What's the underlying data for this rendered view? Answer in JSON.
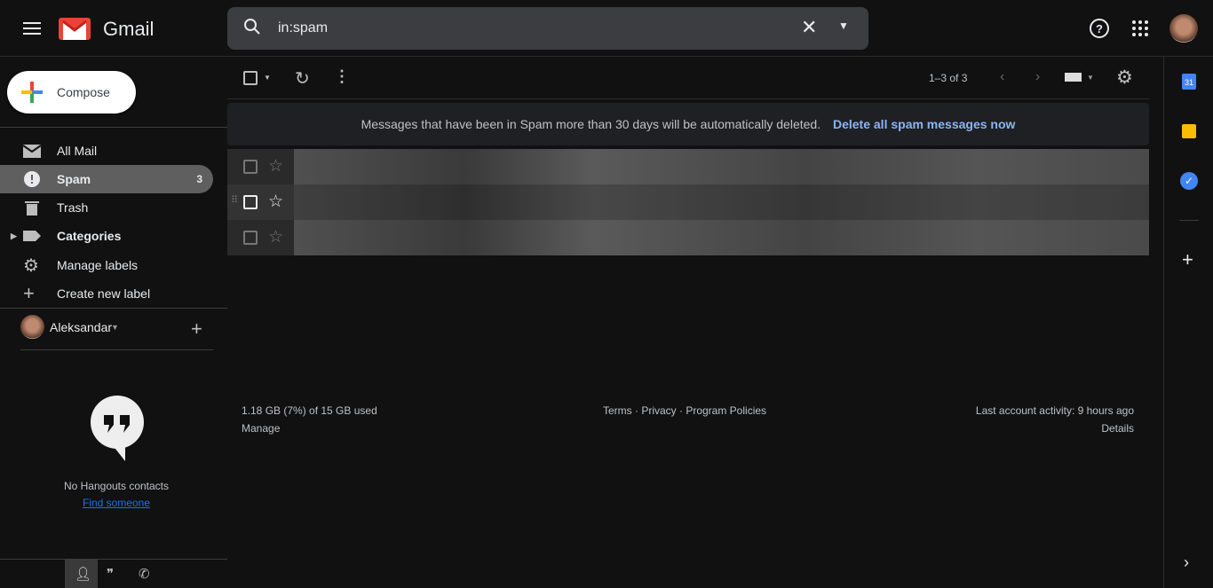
{
  "header": {
    "app_name": "Gmail",
    "search_value": "in:spam"
  },
  "sidebar": {
    "compose": "Compose",
    "items": [
      {
        "label": "All Mail",
        "icon": "mail-icon"
      },
      {
        "label": "Spam",
        "icon": "spam-icon",
        "count": "3",
        "selected": true
      },
      {
        "label": "Trash",
        "icon": "trash-icon"
      },
      {
        "label": "Categories",
        "icon": "label-icon"
      },
      {
        "label": "Manage labels",
        "icon": "gear-icon"
      },
      {
        "label": "Create new label",
        "icon": "plus-icon"
      }
    ],
    "hangouts_user": "Aleksandar",
    "no_contacts": "No Hangouts contacts",
    "find_someone": "Find someone"
  },
  "toolbar": {
    "pagination": "1–3 of 3"
  },
  "banner": {
    "text": "Messages that have been in Spam more than 30 days will be automatically deleted.",
    "action": "Delete all spam messages now"
  },
  "footer": {
    "storage": "1.18 GB (7%) of 15 GB used",
    "manage": "Manage",
    "links": "Terms · Privacy · Program Policies",
    "activity": "Last account activity: 9 hours ago",
    "details": "Details"
  },
  "colors": {
    "accent": "#8ab4f8",
    "link": "#1a73e8",
    "selected": "#5f5f5f"
  }
}
